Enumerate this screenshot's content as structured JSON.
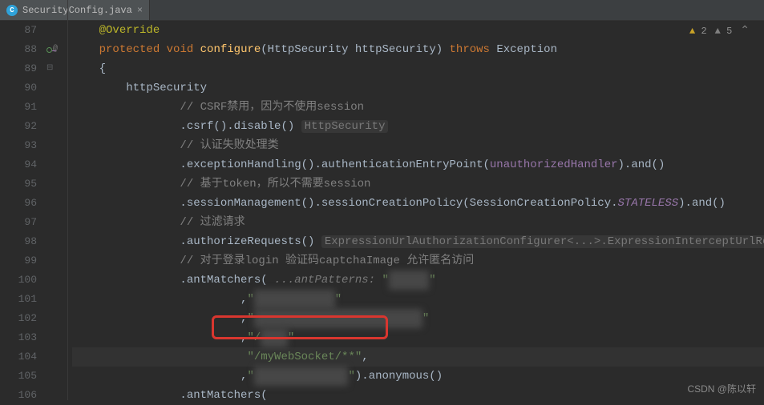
{
  "tab": {
    "filename": "SecurityConfig.java"
  },
  "warnings": {
    "yellow_count": "2",
    "gray_count": "5"
  },
  "watermark": "CSDN @陈以轩",
  "lines": {
    "87": {
      "anno": "@Override"
    },
    "88": {
      "kw1": "protected",
      "kw2": "void",
      "method": "configure",
      "paren1": "(HttpSecurity httpSecurity) ",
      "kw3": "throws",
      "exc": " Exception"
    },
    "89": {
      "brace": "{"
    },
    "90": {
      "stmt": "httpSecurity"
    },
    "91": {
      "comment": "// CSRF禁用，因为不使用session"
    },
    "92": {
      "call": ".csrf().disable()",
      "hint": "HttpSecurity"
    },
    "93": {
      "comment": "// 认证失败处理类"
    },
    "94": {
      "call": ".exceptionHandling().authenticationEntryPoint(",
      "field": "unauthorizedHandler",
      "after": ").and()"
    },
    "95": {
      "comment": "// 基于token，所以不需要session"
    },
    "96": {
      "call": ".sessionManagement().sessionCreationPolicy(SessionCreationPolicy.",
      "enum": "STATELESS",
      "after": ").and()"
    },
    "97": {
      "comment": "// 过滤请求"
    },
    "98": {
      "call": ".authorizeRequests()",
      "hint": "ExpressionUrlAuthorizationConfigurer<...>.ExpressionInterceptUrlRegistry"
    },
    "99": {
      "comment": "// 对于登录login 验证码captchaImage 允许匿名访问"
    },
    "100": {
      "call": ".antMatchers(",
      "param": " ...antPatterns: ",
      "str_open": "\"",
      "blur": "xxxxxx",
      "str_close": "\""
    },
    "101": {
      "comma": ",",
      "q1": "\"",
      "blur": "xxxxxxxxxxxx",
      "q2": "\""
    },
    "102": {
      "comma": ",",
      "q1": "\"",
      "blur": "xxxxxxxxxxxxxxxxxxxxxxxxx",
      "q2": "\""
    },
    "103": {
      "comma": ",",
      "q1": "\"/",
      "blur": "xxxx",
      "q2": "\""
    },
    "104": {
      "str": "\"/myWebSocket/**\"",
      "comma": ","
    },
    "105": {
      "comma": ",",
      "q1": "\"",
      "blur": "xxxxxxxxxxxxxx",
      "q2": "\"",
      "after": ").anonymous()"
    },
    "106": {
      "call": ".antMatchers("
    }
  }
}
